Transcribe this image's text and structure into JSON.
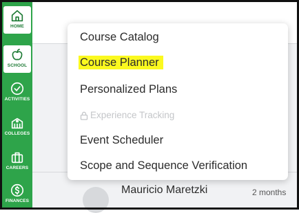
{
  "sidebar": {
    "items": [
      {
        "label": "HOME",
        "icon": "home-icon"
      },
      {
        "label": "SCHOOL",
        "icon": "apple-icon"
      },
      {
        "label": "ACTIVITIES",
        "icon": "check-circle-icon"
      },
      {
        "label": "COLLEGES",
        "icon": "college-icon"
      },
      {
        "label": "CAREERS",
        "icon": "briefcase-icon"
      },
      {
        "label": "FINANCES",
        "icon": "dollar-icon"
      }
    ],
    "color": "#2ea44a"
  },
  "menu": {
    "items": [
      {
        "label": "Course Catalog"
      },
      {
        "label": "Course Planner",
        "highlighted": true
      },
      {
        "label": "Personalized Plans"
      },
      {
        "label": "Experience Tracking",
        "disabled": true,
        "icon": "lock-icon"
      },
      {
        "label": "Event Scheduler"
      },
      {
        "label": "Scope and Sequence Verification"
      }
    ],
    "highlight_color": "#fbf91f"
  },
  "background": {
    "row": {
      "name": "Mauricio Maretzki",
      "time": "2 months"
    }
  }
}
